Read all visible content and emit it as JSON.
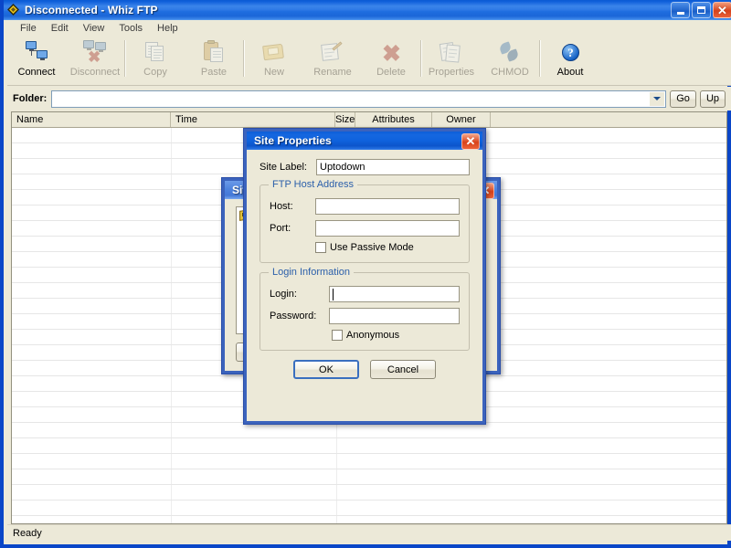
{
  "window": {
    "title": "Disconnected - Whiz FTP",
    "icon": "whiz-ftp-diamond-icon",
    "minimize_label": "Minimize",
    "maximize_label": "Maximize",
    "close_label": "✕"
  },
  "menu": {
    "items": [
      "File",
      "Edit",
      "View",
      "Tools",
      "Help"
    ]
  },
  "toolbar": {
    "buttons": [
      {
        "label": "Connect",
        "icon": "connect-network-icon",
        "enabled": true
      },
      {
        "label": "Disconnect",
        "icon": "disconnect-network-icon",
        "enabled": false
      },
      {
        "label": "Copy",
        "icon": "copy-pages-icon",
        "enabled": false
      },
      {
        "label": "Paste",
        "icon": "paste-clipboard-icon",
        "enabled": false
      },
      {
        "label": "New",
        "icon": "new-folder-icon",
        "enabled": false
      },
      {
        "label": "Rename",
        "icon": "rename-pencil-icon",
        "enabled": false
      },
      {
        "label": "Delete",
        "icon": "delete-x-icon",
        "enabled": false
      },
      {
        "label": "Properties",
        "icon": "properties-pages-icon",
        "enabled": false
      },
      {
        "label": "CHMOD",
        "icon": "chmod-arrows-icon",
        "enabled": false
      },
      {
        "label": "About",
        "icon": "about-help-icon",
        "enabled": true
      }
    ]
  },
  "folderbar": {
    "label": "Folder:",
    "value": "",
    "placeholder": "",
    "go_label": "Go",
    "up_label": "Up"
  },
  "filelist": {
    "columns": [
      {
        "label": "Name",
        "align": "left"
      },
      {
        "label": "Time",
        "align": "left"
      },
      {
        "label": "Size",
        "align": "right"
      },
      {
        "label": "Attributes",
        "align": "center"
      },
      {
        "label": "Owner",
        "align": "center"
      },
      {
        "label": "",
        "align": "left"
      }
    ],
    "rows": []
  },
  "statusbar": {
    "text": "Ready"
  },
  "background_dialog": {
    "title": "Site",
    "close_label": "✕",
    "list_item_label": "",
    "list_item_icon": "site-key-icon"
  },
  "site_properties_dialog": {
    "title": "Site Properties",
    "close_label": "✕",
    "site_label_caption": "Site Label:",
    "site_label_value": "Uptodown",
    "host_group": {
      "title": "FTP Host Address",
      "host_caption": "Host:",
      "host_value": "",
      "port_caption": "Port:",
      "port_value": "",
      "passive_label": "Use Passive Mode",
      "passive_checked": false
    },
    "login_group": {
      "title": "Login Information",
      "login_caption": "Login:",
      "login_value": "",
      "login_focused": true,
      "password_caption": "Password:",
      "password_value": "",
      "anonymous_label": "Anonymous",
      "anonymous_checked": false
    },
    "ok_label": "OK",
    "cancel_label": "Cancel"
  },
  "colors": {
    "titlebar_blue": "#0a5bd3",
    "dialog_title_blue": "#0d5ed8",
    "dialog_border_blue": "#3b63bd",
    "window_face": "#ece9d8",
    "group_title": "#2b5faa",
    "close_red": "#d8421b",
    "disabled_text": "#a6a295"
  }
}
